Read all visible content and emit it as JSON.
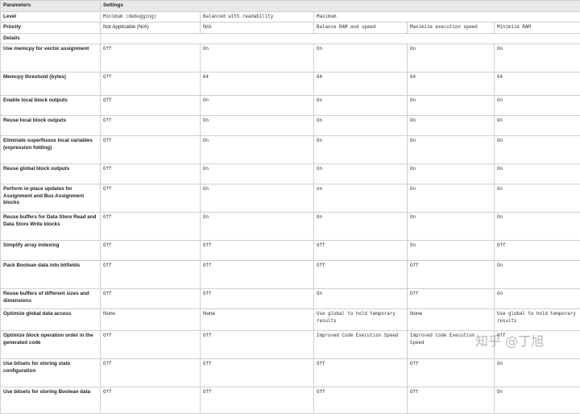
{
  "header": {
    "col1": "Parameters",
    "col2": "Settings"
  },
  "level": {
    "label": "Level",
    "values": [
      "Minimum (debugging)",
      "Balanced with readability",
      "Maximum"
    ]
  },
  "priority": {
    "label": "Priority",
    "values": [
      "Not Applicable (N/A)",
      "N/A",
      "Balance RAM and speed",
      "Maximize execution speed",
      "Minimize RAM"
    ]
  },
  "details_label": "Details",
  "rows": [
    {
      "label": "Use memcpy for vector assignment",
      "values": [
        "Off",
        "On",
        "On",
        "On",
        "On"
      ]
    },
    {
      "label": "Memcpy threshold (bytes)",
      "values": [
        "Off",
        "64",
        "64",
        "64",
        "64"
      ]
    },
    {
      "label": "Enable local block outputs",
      "values": [
        "Off",
        "On",
        "On",
        "On",
        "On"
      ]
    },
    {
      "label": "Reuse local block outputs",
      "values": [
        "Off",
        "On",
        "On",
        "On",
        "On"
      ]
    },
    {
      "label": "Eliminate superfluous local variables (expression folding)",
      "values": [
        "Off",
        "On",
        "On",
        "On",
        "On"
      ]
    },
    {
      "label": "Reuse global block outputs",
      "values": [
        "Off",
        "On",
        "On",
        "On",
        "On"
      ]
    },
    {
      "label": "Perform in-place updates for Assignment and Bus Assignment blocks",
      "values": [
        "Off",
        "On",
        "on",
        "On",
        "On"
      ]
    },
    {
      "label": "Reuse buffers for Data Store Read and Data Store Write blocks",
      "values": [
        "Off",
        "On",
        "On",
        "On",
        "On"
      ]
    },
    {
      "label": "Simplify array indexing",
      "values": [
        "Off",
        "Off",
        "Off",
        "On",
        "Off"
      ]
    },
    {
      "label": "Pack Boolean data into bitfields",
      "values": [
        "Off",
        "Off",
        "Off",
        "Off",
        "On"
      ]
    },
    {
      "label": "Reuse buffers of different sizes and dimensions",
      "values": [
        "Off",
        "Off",
        "On",
        "Off",
        "On"
      ]
    },
    {
      "label": "Optimize global data access",
      "values": [
        "None",
        "None",
        "Use global to hold temporary results",
        "None",
        "Use global to hold temporary results"
      ]
    },
    {
      "label": "Optimize block operation order in the generated code",
      "values": [
        "Off",
        "Off",
        "Improved Code Execution Speed",
        "Improved Code Execution Speed",
        "Off"
      ]
    },
    {
      "label": "Use bitsets for storing state configuration",
      "values": [
        "Off",
        "Off",
        "Off",
        "Off",
        "On"
      ]
    },
    {
      "label": "Use bitsets for storing Boolean data",
      "values": [
        "Off",
        "Off",
        "Off",
        "Off",
        "On"
      ]
    }
  ],
  "watermark": "知乎 @丁旭"
}
